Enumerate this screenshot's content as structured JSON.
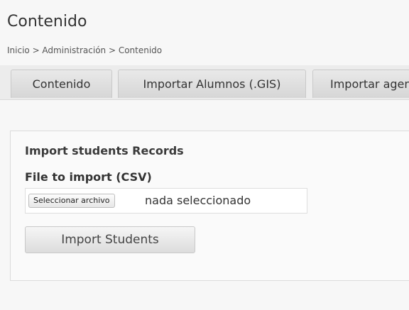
{
  "page": {
    "title": "Contenido"
  },
  "breadcrumb": {
    "text": "Inicio > Administración > Contenido"
  },
  "tabs": [
    {
      "label": "Contenido"
    },
    {
      "label": "Importar Alumnos (.GIS)"
    },
    {
      "label": "Importar agendas"
    }
  ],
  "import_section": {
    "heading": "Import students Records",
    "file_label": "File to import (CSV)",
    "file_button_label": "Seleccionar archivo",
    "file_status": "nada seleccionado",
    "submit_label": "Import Students"
  }
}
